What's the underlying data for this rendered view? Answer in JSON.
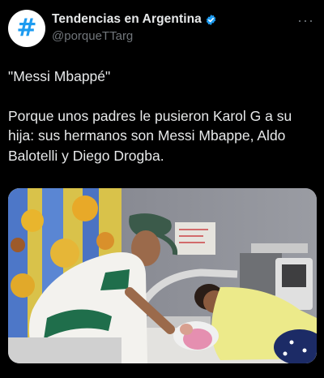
{
  "account": {
    "display_name": "Tendencias en Argentina",
    "handle": "@porqueTTarg",
    "avatar_glyph": "#",
    "verified": true,
    "verified_icon": "verified-badge-icon",
    "brand_color": "#1d9bf0"
  },
  "menu": {
    "more_label": "···"
  },
  "tweet": {
    "paragraphs": [
      "\"Messi Mbappé\"",
      "Porque unos padres le pusieron Karol G a su hija: sus hermanos son Messi Mbappe, Aldo Balotelli y Diego Drogba."
    ]
  },
  "media": {
    "kind": "photo",
    "description_icon": "hospital-photo"
  },
  "colors": {
    "background": "#000000",
    "text": "#e7e9ea",
    "secondary": "#71767b"
  }
}
